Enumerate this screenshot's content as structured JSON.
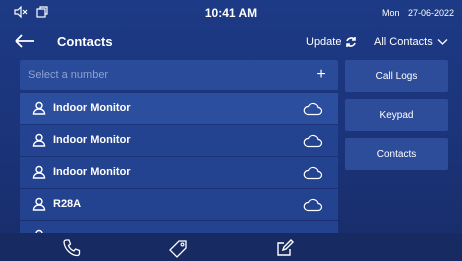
{
  "status_bar": {
    "time": "10:41 AM",
    "day": "Mon",
    "date": "27-06-2022",
    "icons": [
      "speaker-mute-icon",
      "screen-mirror-icon"
    ]
  },
  "header": {
    "title": "Contacts",
    "update_label": "Update",
    "filter_label": "All Contacts"
  },
  "search": {
    "placeholder": "Select a number"
  },
  "contacts": [
    {
      "name": "Indoor Monitor",
      "icon": "person-icon",
      "source_icon": "cloud-icon"
    },
    {
      "name": "Indoor Monitor",
      "icon": "person-icon",
      "source_icon": "cloud-icon"
    },
    {
      "name": "Indoor Monitor",
      "icon": "person-icon",
      "source_icon": "cloud-icon"
    },
    {
      "name": "R28A",
      "icon": "person-icon",
      "source_icon": "cloud-icon"
    }
  ],
  "side_menu": {
    "call_logs": "Call Logs",
    "keypad": "Keypad",
    "contacts": "Contacts"
  },
  "bottom_nav": [
    "phone-icon",
    "tag-icon",
    "edit-icon"
  ],
  "colors": {
    "background": "#1b347a",
    "list_item": "#23428f",
    "side_button": "#2d4d9a"
  }
}
